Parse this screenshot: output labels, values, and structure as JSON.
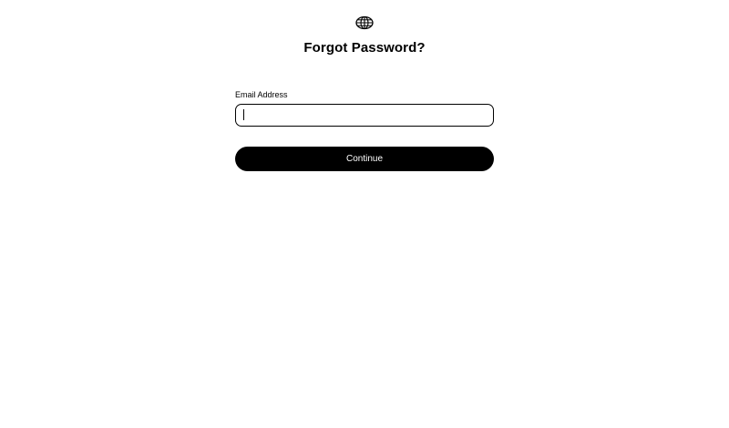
{
  "header": {
    "logo_icon": "globe-icon",
    "title": "Forgot Password?"
  },
  "form": {
    "email": {
      "label": "Email Address",
      "value": "",
      "placeholder": ""
    },
    "continue_label": "Continue"
  },
  "colors": {
    "background": "#ffffff",
    "primary": "#000000",
    "button_text": "#ffffff"
  }
}
